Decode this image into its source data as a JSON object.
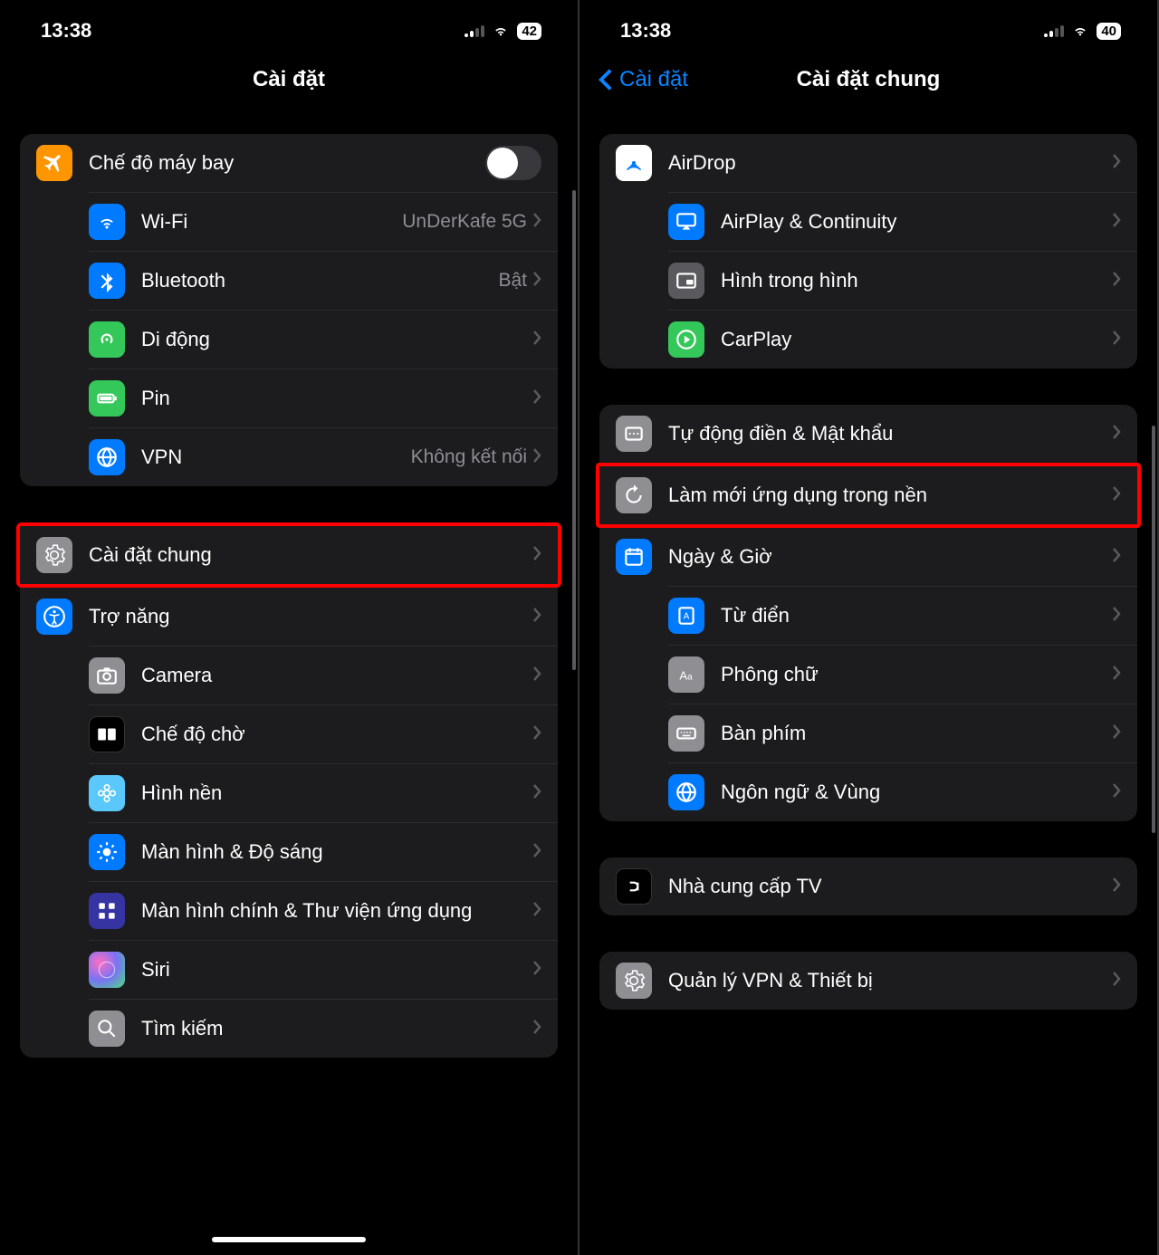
{
  "left": {
    "status": {
      "time": "13:38",
      "battery": "42"
    },
    "nav": {
      "title": "Cài đặt"
    },
    "group1": [
      {
        "id": "airplane",
        "label": "Chế độ máy bay",
        "value": "",
        "toggle": true,
        "icon_bg": "#FF9500"
      },
      {
        "id": "wifi",
        "label": "Wi-Fi",
        "value": "UnDerKafe 5G",
        "icon_bg": "#007AFF"
      },
      {
        "id": "bluetooth",
        "label": "Bluetooth",
        "value": "Bật",
        "icon_bg": "#007AFF"
      },
      {
        "id": "cellular",
        "label": "Di động",
        "value": "",
        "icon_bg": "#34C759"
      },
      {
        "id": "battery",
        "label": "Pin",
        "value": "",
        "icon_bg": "#34C759"
      },
      {
        "id": "vpn",
        "label": "VPN",
        "value": "Không kết nối",
        "icon_bg": "#007AFF"
      }
    ],
    "general_row": {
      "label": "Cài đặt chung",
      "icon_bg": "#8E8E93"
    },
    "group2": [
      {
        "id": "accessibility",
        "label": "Trợ năng",
        "icon_bg": "#007AFF"
      },
      {
        "id": "camera",
        "label": "Camera",
        "icon_bg": "#8E8E93"
      },
      {
        "id": "standby",
        "label": "Chế độ chờ",
        "icon_bg": "#000000"
      },
      {
        "id": "wallpaper",
        "label": "Hình nền",
        "icon_bg": "#34AADC"
      },
      {
        "id": "display",
        "label": "Màn hình & Độ sáng",
        "icon_bg": "#007AFF"
      },
      {
        "id": "homescreen",
        "label": "Màn hình chính & Thư viện ứng dụng",
        "icon_bg": "#3A3A8F"
      },
      {
        "id": "siri",
        "label": "Siri",
        "icon_bg": "#2C2C2E"
      },
      {
        "id": "search",
        "label": "Tìm kiếm",
        "icon_bg": "#8E8E93"
      }
    ]
  },
  "right": {
    "status": {
      "time": "13:38",
      "battery": "40"
    },
    "nav": {
      "back": "Cài đặt",
      "title": "Cài đặt chung"
    },
    "group1": [
      {
        "id": "airdrop",
        "label": "AirDrop",
        "icon_bg": "#FFFFFF",
        "dark": true
      },
      {
        "id": "airplay",
        "label": "AirPlay & Continuity",
        "icon_bg": "#007AFF"
      },
      {
        "id": "pip",
        "label": "Hình trong hình",
        "icon_bg": "#5A5A5E"
      },
      {
        "id": "carplay",
        "label": "CarPlay",
        "icon_bg": "#34C759"
      }
    ],
    "autofill_row": {
      "label": "Tự động điền & Mật khẩu",
      "icon_bg": "#8E8E93"
    },
    "refresh_row": {
      "label": "Làm mới ứng dụng trong nền",
      "icon_bg": "#8E8E93"
    },
    "group2": [
      {
        "id": "datetime",
        "label": "Ngày & Giờ",
        "icon_bg": "#007AFF"
      },
      {
        "id": "dict",
        "label": "Từ điển",
        "icon_bg": "#007AFF"
      },
      {
        "id": "fonts",
        "label": "Phông chữ",
        "icon_bg": "#8E8E93"
      },
      {
        "id": "keyboard",
        "label": "Bàn phím",
        "icon_bg": "#8E8E93"
      },
      {
        "id": "language",
        "label": "Ngôn ngữ & Vùng",
        "icon_bg": "#007AFF"
      }
    ],
    "group3": [
      {
        "id": "tv",
        "label": "Nhà cung cấp TV",
        "icon_bg": "#000000"
      }
    ],
    "group4": [
      {
        "id": "vpnmgmt",
        "label": "Quản lý VPN & Thiết bị",
        "icon_bg": "#8E8E93"
      }
    ]
  }
}
